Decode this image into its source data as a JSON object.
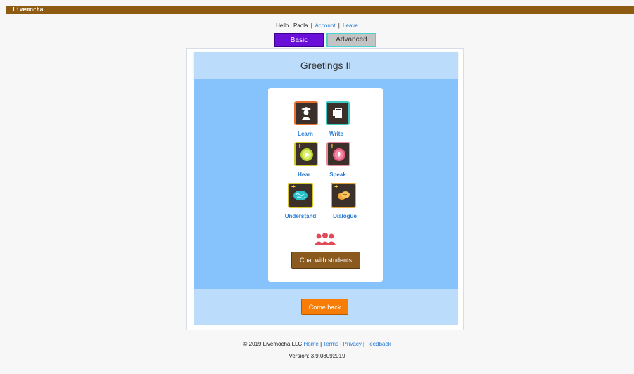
{
  "app": {
    "brand": "Livemocha"
  },
  "user_bar": {
    "greeting": "Hello , Paola",
    "separator": "|",
    "account_link": "Account",
    "leave_link": "Leave"
  },
  "tabs": [
    {
      "label": "Basic",
      "active": true
    },
    {
      "label": "Advanced",
      "active": false
    }
  ],
  "lesson": {
    "title": "Greetings II"
  },
  "activities": [
    {
      "label": "Learn",
      "icon": "teacher-icon",
      "border": "#e6712e"
    },
    {
      "label": "Write",
      "icon": "notebook-icon",
      "border": "#40c9c4"
    },
    {
      "label": "Hear",
      "icon": "play-icon",
      "border": "#d3c62c"
    },
    {
      "label": "Speak",
      "icon": "microphone-icon",
      "border": "#e58ca1"
    },
    {
      "label": "Understand",
      "icon": "brain-icon",
      "border": "#d9c52d"
    },
    {
      "label": "Dialogue",
      "icon": "speech-bubbles-icon",
      "border": "#e0a43a"
    }
  ],
  "chat": {
    "icon": "people-icon",
    "button_label": "Chat with students"
  },
  "come_back_label": "Come back",
  "footer": {
    "copyright": "© 2019 Livemocha LLC",
    "separator": "|",
    "links": [
      "Home",
      "Terms",
      "Privacy",
      "Feedback"
    ],
    "version_label": "Version:",
    "version": "3.9.08092019"
  },
  "colors": {
    "topbar": "#8f5b12",
    "basic_tab": "#6a0fd8",
    "advanced_tab": "#c4c4c4",
    "light_blue": "#bcdcfb",
    "blue": "#86c2fb",
    "chat_button": "#8b5a1f",
    "come_back_button": "#f77d07",
    "link": "#2a7ad3"
  }
}
